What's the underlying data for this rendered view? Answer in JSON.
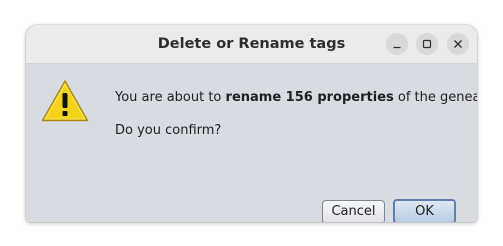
{
  "dialog": {
    "title": "Delete or Rename tags",
    "message_prefix": "You are about to ",
    "message_bold": "rename 156 properties",
    "message_suffix": " of the genealogy.",
    "question": "Do you confirm?"
  },
  "buttons": {
    "cancel_label": "Cancel",
    "ok_label": "OK"
  },
  "window_controls": [
    "minimize-icon",
    "maximize-icon",
    "close-icon"
  ],
  "icons": {
    "dialog_icon": "warning-icon"
  },
  "colors": {
    "warning_fill": "#f5d31b",
    "ok_border": "#5e82ad",
    "dialog_background": "#d8dbe2"
  }
}
